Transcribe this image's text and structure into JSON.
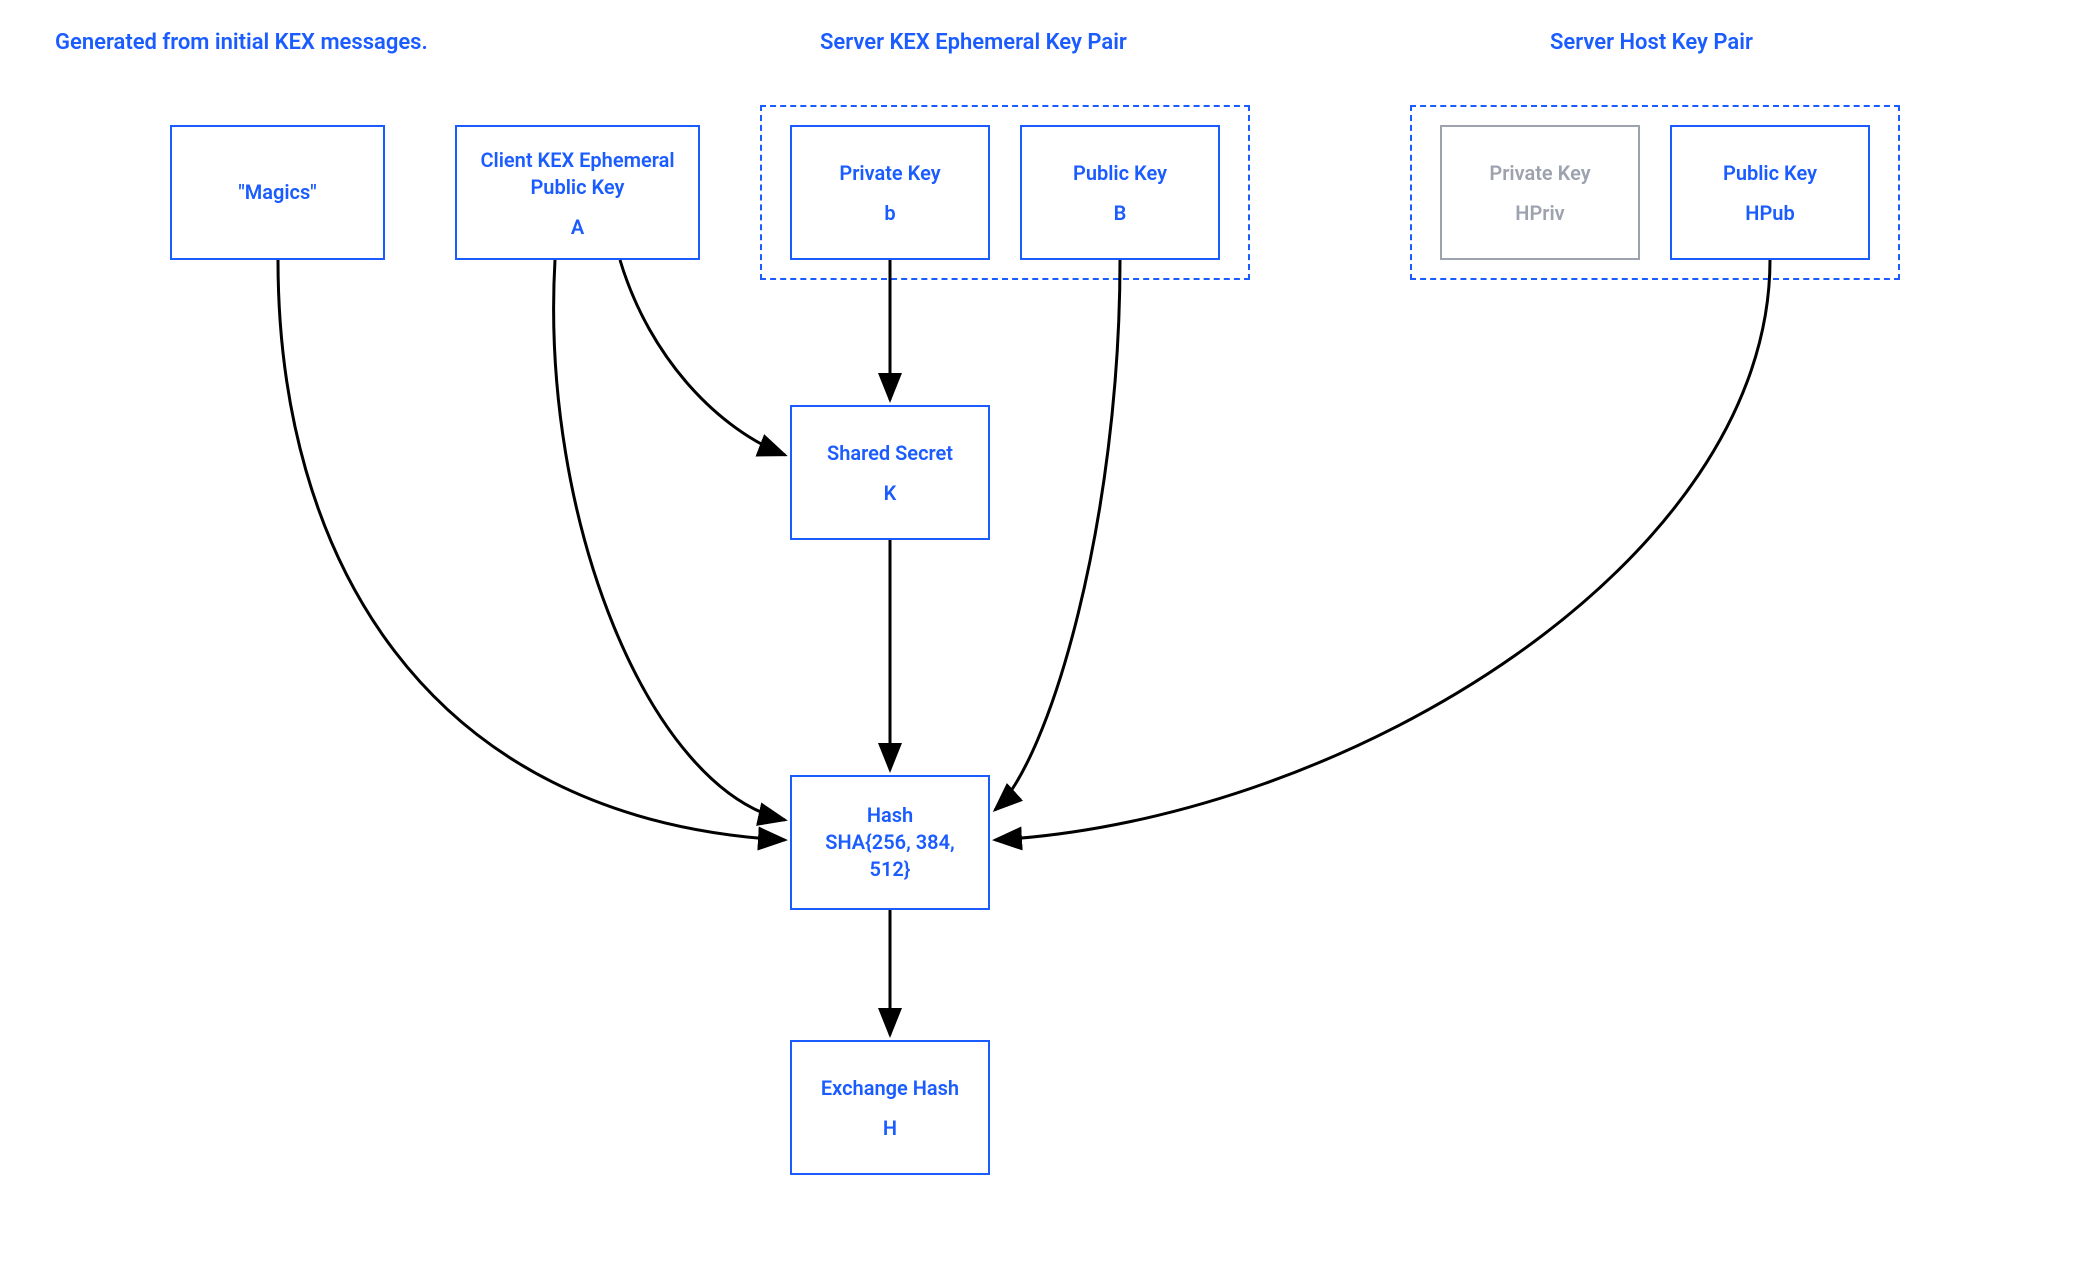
{
  "titles": {
    "left": "Generated from initial KEX messages.",
    "mid": "Server KEX Ephemeral Key Pair",
    "right": "Server Host Key Pair"
  },
  "boxes": {
    "magics": {
      "label": "\"Magics\""
    },
    "clientKex": {
      "label": "Client KEX Ephemeral\nPublic Key",
      "sublabel": "A"
    },
    "privKey": {
      "label": "Private Key",
      "sublabel": "b"
    },
    "pubKey": {
      "label": "Public Key",
      "sublabel": "B"
    },
    "hpriv": {
      "label": "Private Key",
      "sublabel": "HPriv"
    },
    "hpub": {
      "label": "Public Key",
      "sublabel": "HPub"
    },
    "shared": {
      "label": "Shared Secret",
      "sublabel": "K"
    },
    "hash": {
      "label": "Hash\nSHA{256, 384, 512}"
    },
    "exch": {
      "label": "Exchange Hash",
      "sublabel": "H"
    }
  }
}
